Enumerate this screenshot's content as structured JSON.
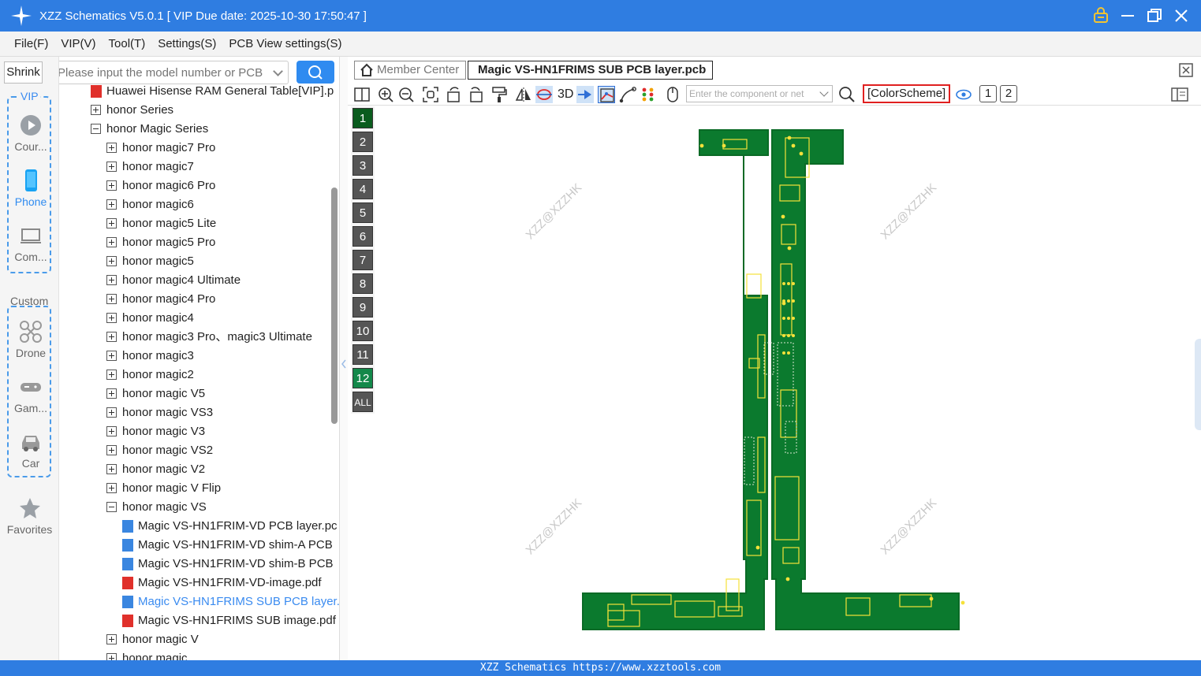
{
  "app": {
    "title": "XZZ Schematics V5.0.1 [ VIP Due date: 2025-10-30 17:50:47 ]",
    "accent_color": "#2f7de1",
    "window_icons": [
      "lock-icon",
      "minimize-icon",
      "restore-icon",
      "close-icon"
    ]
  },
  "menu": {
    "items": [
      "File(F)",
      "VIP(V)",
      "Tool(T)",
      "Settings(S)",
      "PCB View settings(S)"
    ]
  },
  "leftnav": {
    "shrink_label": "Shrink",
    "vip_label": "VIP",
    "vip_items": [
      {
        "label": "Cour...",
        "icon": "play-icon"
      },
      {
        "label": "Phone",
        "icon": "phone-icon"
      },
      {
        "label": "Com...",
        "icon": "laptop-icon"
      }
    ],
    "custom_label": "Custom",
    "custom_items": [
      {
        "label": "Drone",
        "icon": "drone-icon"
      },
      {
        "label": "Gam...",
        "icon": "gamepad-icon"
      },
      {
        "label": "Car",
        "icon": "car-icon"
      }
    ],
    "favorites_label": "Favorites"
  },
  "search": {
    "placeholder": "Please input the model number or PCB"
  },
  "tree": {
    "rows": [
      {
        "label": "Huawei Hisense RAM General Table[VIP].p",
        "level": 0,
        "type": "pdf"
      },
      {
        "label": "honor Series",
        "level": 0,
        "type": "plus"
      },
      {
        "label": "honor Magic Series",
        "level": 0,
        "type": "minus"
      },
      {
        "label": "honor magic7 Pro",
        "level": 1,
        "type": "plus"
      },
      {
        "label": "honor magic7",
        "level": 1,
        "type": "plus"
      },
      {
        "label": "honor magic6 Pro",
        "level": 1,
        "type": "plus"
      },
      {
        "label": "honor magic6",
        "level": 1,
        "type": "plus"
      },
      {
        "label": "honor magic5 Lite",
        "level": 1,
        "type": "plus"
      },
      {
        "label": "honor magic5 Pro",
        "level": 1,
        "type": "plus"
      },
      {
        "label": "honor magic5",
        "level": 1,
        "type": "plus"
      },
      {
        "label": "honor magic4 Ultimate",
        "level": 1,
        "type": "plus"
      },
      {
        "label": "honor magic4 Pro",
        "level": 1,
        "type": "plus"
      },
      {
        "label": "honor magic4",
        "level": 1,
        "type": "plus"
      },
      {
        "label": "honor magic3 Pro、magic3 Ultimate",
        "level": 1,
        "type": "plus"
      },
      {
        "label": "honor magic3",
        "level": 1,
        "type": "plus"
      },
      {
        "label": "honor magic2",
        "level": 1,
        "type": "plus"
      },
      {
        "label": "honor magic V5",
        "level": 1,
        "type": "plus"
      },
      {
        "label": "honor magic VS3",
        "level": 1,
        "type": "plus"
      },
      {
        "label": "honor magic V3",
        "level": 1,
        "type": "plus"
      },
      {
        "label": "honor magic VS2",
        "level": 1,
        "type": "plus"
      },
      {
        "label": "honor magic V2",
        "level": 1,
        "type": "plus"
      },
      {
        "label": "honor magic V Flip",
        "level": 1,
        "type": "plus"
      },
      {
        "label": "honor magic VS",
        "level": 1,
        "type": "minus"
      },
      {
        "label": "Magic VS-HN1FRIM-VD PCB layer.pc",
        "level": 2,
        "type": "pcb"
      },
      {
        "label": "Magic VS-HN1FRIM-VD shim-A PCB",
        "level": 2,
        "type": "pcb"
      },
      {
        "label": "Magic VS-HN1FRIM-VD shim-B PCB",
        "level": 2,
        "type": "pcb"
      },
      {
        "label": "Magic VS-HN1FRIM-VD-image.pdf",
        "level": 2,
        "type": "pdf"
      },
      {
        "label": "Magic VS-HN1FRIMS SUB PCB layer.",
        "level": 2,
        "type": "pcb",
        "active": true
      },
      {
        "label": "Magic VS-HN1FRIMS SUB image.pdf",
        "level": 2,
        "type": "pdf"
      },
      {
        "label": "honor magic V",
        "level": 1,
        "type": "plus"
      },
      {
        "label": "honor magic",
        "level": 1,
        "type": "plus"
      }
    ]
  },
  "tabs": {
    "home_label": "Member Center",
    "active_label": "Magic VS-HN1FRIMS SUB PCB layer.pcb"
  },
  "toolbar": {
    "label_3d": "3D",
    "component_placeholder": "Enter the component or net",
    "colorscheme_label": "[ColorScheme]",
    "view1_label": "1",
    "view2_label": "2"
  },
  "layers": [
    "1",
    "2",
    "3",
    "4",
    "5",
    "6",
    "7",
    "8",
    "9",
    "10",
    "11",
    "12",
    "ALL"
  ],
  "watermark": "XZZ@XZZHK",
  "pcb_colors": {
    "board": "#0b7a2e",
    "edge": "#0a6a26",
    "pad": "#f5e13a",
    "outline": "#d9e6d0"
  },
  "statusbar": {
    "text": "XZZ Schematics https://www.xzztools.com"
  }
}
